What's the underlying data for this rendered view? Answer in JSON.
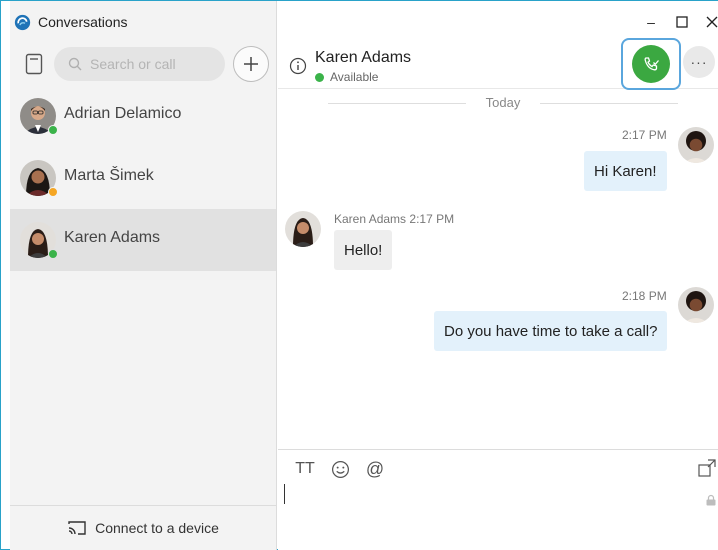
{
  "app": {
    "title": "Conversations",
    "logo_icon": "app-logo-icon"
  },
  "sidebar": {
    "search_placeholder": "Search or call",
    "conversations": [
      {
        "name": "Adrian Delamico",
        "presence": "available",
        "presence_color": "#3bb34a",
        "selected": false
      },
      {
        "name": "Marta Šimek",
        "presence": "away",
        "presence_color": "#f5a623",
        "selected": false
      },
      {
        "name": "Karen Adams",
        "presence": "available",
        "presence_color": "#3bb34a",
        "selected": true
      }
    ],
    "connect_label": "Connect to a device"
  },
  "window_controls": {
    "minimize": "–",
    "maximize": "☐",
    "close": "✕"
  },
  "chat_header": {
    "contact_name": "Karen Adams",
    "status": "Available",
    "status_color": "#3bb34a",
    "more_label": "···"
  },
  "messages": {
    "date_separator": "Today",
    "items": [
      {
        "direction": "outgoing",
        "time": "2:17 PM",
        "text": "Hi Karen!"
      },
      {
        "direction": "incoming",
        "sender": "Karen Adams",
        "time": "2:17 PM",
        "text": "Hello!"
      },
      {
        "direction": "outgoing",
        "time": "2:18 PM",
        "text": "Do you have time to take a call?"
      }
    ]
  },
  "composer": {
    "format_label": "TT",
    "mention_label": "@"
  },
  "colors": {
    "accent_call": "#3ba841",
    "call_focus_ring": "#5aa6dd",
    "window_border": "#29a2c9",
    "outgoing_bubble": "#e3f1fb",
    "incoming_bubble": "#eeeeee"
  }
}
